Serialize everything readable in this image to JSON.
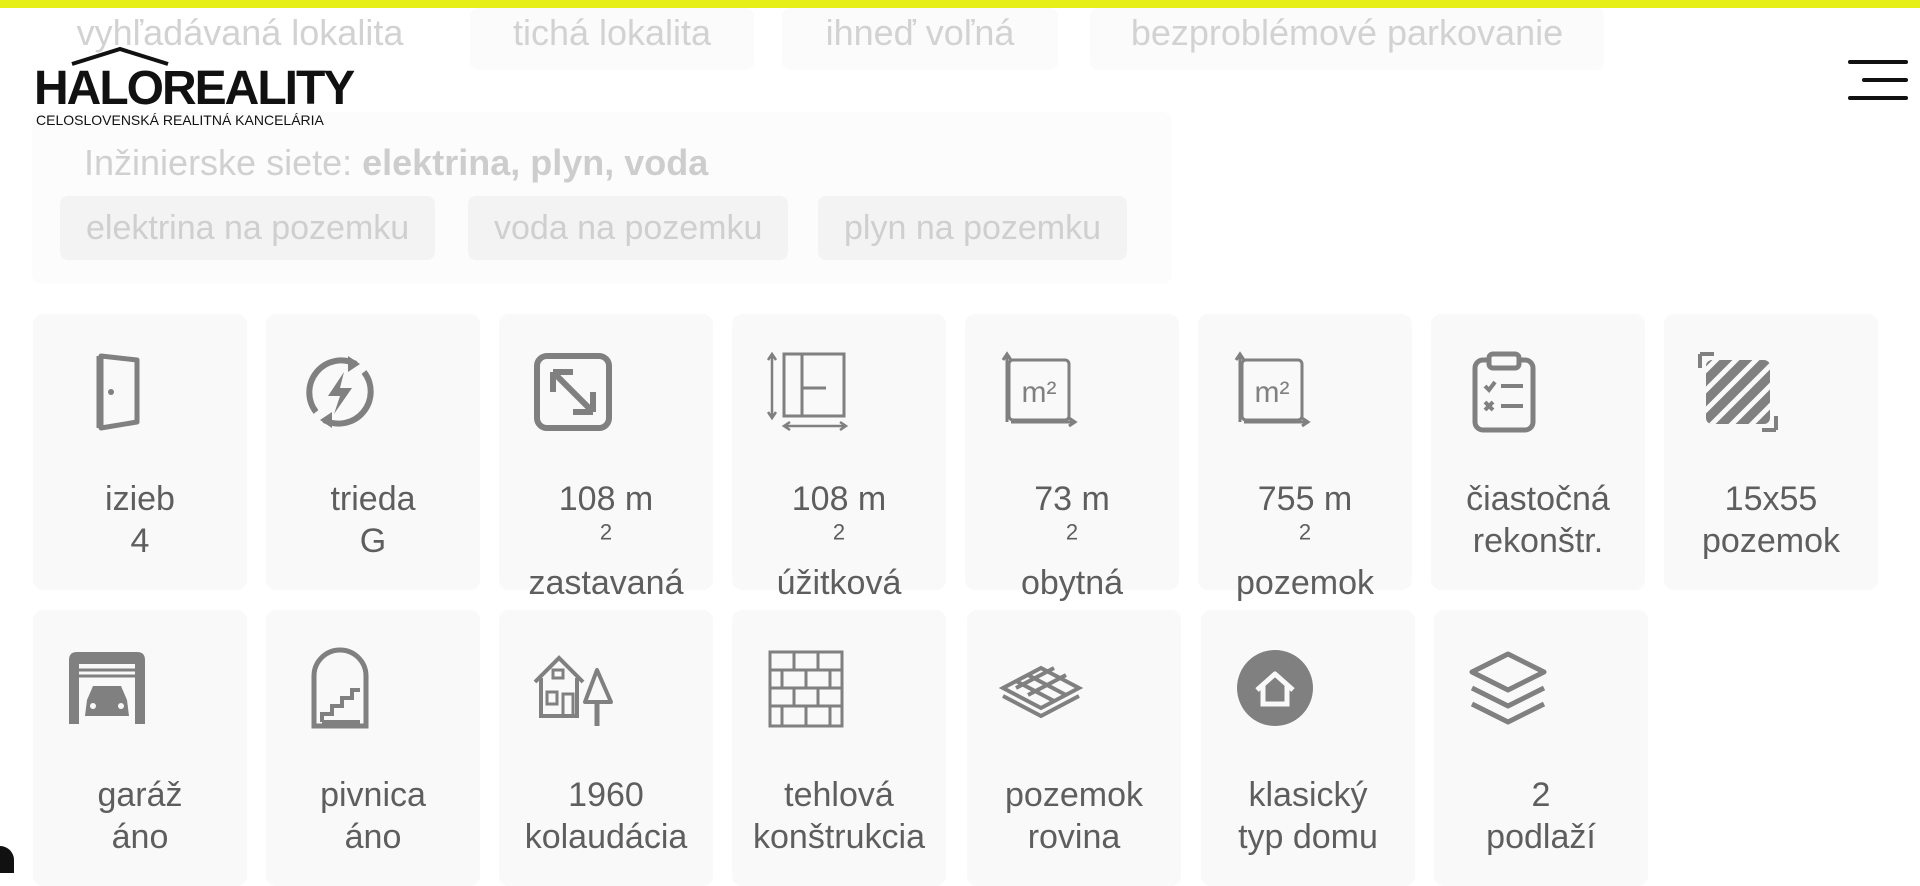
{
  "header": {
    "brand": "HALOREALITY",
    "tagline": "CELOSLOVENSKÁ REALITNÁ KANCELÁRIA"
  },
  "faded_tags": [
    "vyhľadávaná lokalita",
    "tichá lokalita",
    "ihneď voľná",
    "bezproblémové parkovanie"
  ],
  "utilities": {
    "label": "Inžinierske siete:",
    "value": "elektrina, plyn, voda",
    "tags": [
      "elektrina na pozemku",
      "voda na pozemku",
      "plyn na pozemku"
    ]
  },
  "features": [
    {
      "icon": "door-icon",
      "line1": "izieb",
      "line2": "4"
    },
    {
      "icon": "energy-class-icon",
      "line1": "trieda",
      "line2": "G"
    },
    {
      "icon": "built-area-icon",
      "line1": "108 m",
      "sup": "2",
      "line2": "zastavaná"
    },
    {
      "icon": "floor-plan-icon",
      "line1": "108 m",
      "sup": "2",
      "line2": "úžitková"
    },
    {
      "icon": "living-area-icon",
      "line1": "73 m",
      "sup": "2",
      "line2": "obytná"
    },
    {
      "icon": "land-area-icon",
      "line1": "755 m",
      "sup": "2",
      "line2": "pozemok"
    },
    {
      "icon": "checklist-icon",
      "line1": "čiastočná",
      "line2": "rekonštr."
    },
    {
      "icon": "plot-dimensions-icon",
      "line1": "15x55",
      "line2": "pozemok"
    },
    {
      "icon": "garage-icon",
      "line1": "garáž",
      "line2": "áno"
    },
    {
      "icon": "cellar-icon",
      "line1": "pivnica",
      "line2": "áno"
    },
    {
      "icon": "house-tree-icon",
      "line1": "1960",
      "line2": "kolaudácia"
    },
    {
      "icon": "brick-wall-icon",
      "line1": "tehlová",
      "line2": "konštrukcia"
    },
    {
      "icon": "flat-terrain-icon",
      "line1": "pozemok",
      "line2": "rovina"
    },
    {
      "icon": "house-circle-icon",
      "line1": "klasický",
      "line2": "typ domu"
    },
    {
      "icon": "layers-icon",
      "line1": "2",
      "line2": "podlaží"
    }
  ],
  "colors": {
    "accent": "#e7ef19",
    "icon": "#808080",
    "card": "#f9f9f9"
  }
}
